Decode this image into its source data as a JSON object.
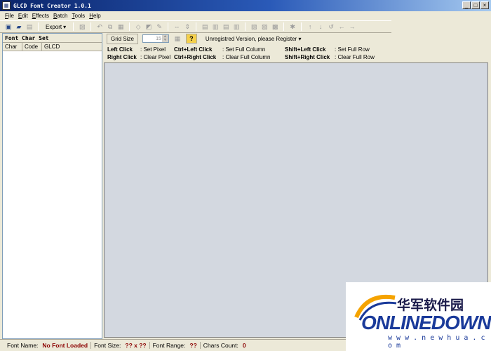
{
  "window": {
    "title": "GLCD Font Creator 1.0.1",
    "minimize": "_",
    "maximize": "□",
    "close": "×"
  },
  "menu": [
    {
      "label": "File",
      "acc": "F",
      "rest": "ile"
    },
    {
      "label": "Edit",
      "acc": "E",
      "rest": "dit"
    },
    {
      "label": "Effects",
      "acc": "E",
      "rest": "ffects"
    },
    {
      "label": "Batch",
      "acc": "B",
      "rest": "atch"
    },
    {
      "label": "Tools",
      "acc": "T",
      "rest": "ools"
    },
    {
      "label": "Help",
      "acc": "H",
      "rest": "elp"
    }
  ],
  "toolbar": {
    "export_label": "Export",
    "export_arrow": "▾"
  },
  "left_panel": {
    "title": "Font Char Set",
    "columns": [
      "Char",
      "Code",
      "GLCD"
    ]
  },
  "options": {
    "grid_size_label": "Grid Size",
    "grid_size_value": "15",
    "help_icon": "?",
    "register_text": "Unregistred Version, please Register",
    "register_arrow": "▾"
  },
  "hints": [
    {
      "key": "Left Click",
      "desc": ": Set Pixel"
    },
    {
      "key": "Right Click",
      "desc": ": Clear Pixel"
    },
    {
      "key": "Ctrl+Left Click",
      "desc": ": Set Full Column"
    },
    {
      "key": "Ctrl+Right Click",
      "desc": ": Clear Full Column"
    },
    {
      "key": "Shift+Left Click",
      "desc": ": Set Full Row"
    },
    {
      "key": "Shift+Right Click",
      "desc": ": Clear Full Row"
    }
  ],
  "status": {
    "font_name_label": "Font Name:",
    "font_name_value": "No Font Loaded",
    "font_size_label": "Font Size:",
    "font_size_value": "?? x ??",
    "font_range_label": "Font Range:",
    "font_range_value": "??",
    "chars_count_label": "Chars Count:",
    "chars_count_value": "0"
  },
  "watermark": {
    "cn": "华军软件园",
    "en": "ONLINEDOWN",
    "url": "w w w . n e w h u a . c o m"
  },
  "colors": {
    "canvas_bg": "#d3d8e0",
    "status_value": "#8b0000",
    "title_bar": "#0a246a"
  }
}
